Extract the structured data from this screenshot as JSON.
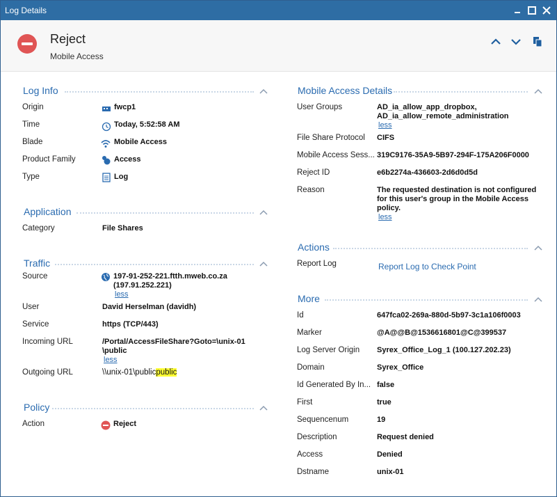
{
  "window": {
    "title": "Log Details"
  },
  "header": {
    "title": "Reject",
    "subtitle": "Mobile Access"
  },
  "log_info": {
    "title": "Log Info",
    "rows": [
      {
        "label": "Origin",
        "value": "fwcp1",
        "icon": "gateway-icon"
      },
      {
        "label": "Time",
        "value": "Today, 5:52:58 AM",
        "icon": "clock-icon"
      },
      {
        "label": "Blade",
        "value": "Mobile Access",
        "icon": "wifi-icon"
      },
      {
        "label": "Product Family",
        "value": "Access",
        "icon": "access-icon"
      },
      {
        "label": "Type",
        "value": "Log",
        "icon": "log-icon"
      }
    ]
  },
  "application": {
    "title": "Application",
    "rows": [
      {
        "label": "Category",
        "value": "File Shares"
      }
    ]
  },
  "traffic": {
    "title": "Traffic",
    "source_label": "Source",
    "source_value_1": "197-91-252-221.ftth.mweb.co.za",
    "source_value_2": "(197.91.252.221)",
    "user_label": "User",
    "user_value": "David Herselman (davidh)",
    "service_label": "Service",
    "service_value": "https (TCP/443)",
    "incoming_label": "Incoming URL",
    "incoming_value_1": "/Portal/AccessFileShare?Goto=\\unix-01",
    "incoming_value_2": "\\public",
    "outgoing_label": "Outgoing URL",
    "outgoing_value": "\\\\unix-01\\public",
    "outgoing_highlight": "public",
    "less": "less"
  },
  "policy": {
    "title": "Policy",
    "action_label": "Action",
    "action_value": "Reject"
  },
  "mobile_access": {
    "title": "Mobile Access Details",
    "user_groups_label": "User Groups",
    "user_groups_1": "AD_ia_allow_app_dropbox,",
    "user_groups_2": "AD_ia_allow_remote_administration",
    "file_share_label": "File Share Protocol",
    "file_share_value": "CIFS",
    "session_label": "Mobile Access Sess...",
    "session_value": "319C9176-35A9-5B97-294F-175A206F0000",
    "reject_id_label": "Reject ID",
    "reject_id_value": "e6b2274a-436603-2d6d0d5d",
    "reason_label": "Reason",
    "reason_1": "The requested destination is not configured",
    "reason_2": "for this user's group in the Mobile Access",
    "reason_3": "policy.",
    "less": "less"
  },
  "actions": {
    "title": "Actions",
    "report_label": "Report Log",
    "report_link": "Report Log to Check Point"
  },
  "more": {
    "title": "More",
    "rows": [
      {
        "label": "Id",
        "value": "647fca02-269a-880d-5b97-3c1a106f0003"
      },
      {
        "label": "Marker",
        "value": "@A@@B@1536616801@C@399537"
      },
      {
        "label": "Log Server Origin",
        "value": "Syrex_Office_Log_1 (100.127.202.23)"
      },
      {
        "label": "Domain",
        "value": "Syrex_Office"
      },
      {
        "label": "Id Generated By In...",
        "value": "false"
      },
      {
        "label": "First",
        "value": "true"
      },
      {
        "label": "Sequencenum",
        "value": "19"
      },
      {
        "label": "Description",
        "value": "Request denied"
      },
      {
        "label": "Access",
        "value": "Denied"
      },
      {
        "label": "Dstname",
        "value": "unix-01"
      }
    ]
  },
  "colors": {
    "titlebar": "#2e6da4",
    "accent": "#2a6bb0",
    "reject": "#e05555",
    "highlight": "#ffff33"
  }
}
